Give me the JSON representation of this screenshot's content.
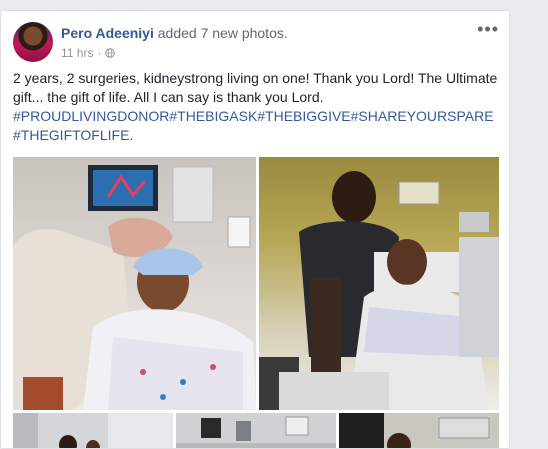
{
  "post": {
    "author": "Pero Adeeniyi",
    "action": "added 7 new photos.",
    "time": "11 hrs",
    "dot": "·",
    "more_glyph": "•••",
    "text_line1": "2 years, 2 surgeries, kidneystrong living on one! Thank you Lord! The Ultimate gift... the gift of life. All I can say is thank you Lord.",
    "hashtags_line1": "#PROUDLIVINGDONOR#THEBIGASK#THEBIGGIVE#SHAREYOURSPARE",
    "hashtags_line2": "#THEGIFTOFLIFE."
  },
  "icons": {
    "privacy": "globe-icon",
    "menu": "more-options-icon"
  }
}
